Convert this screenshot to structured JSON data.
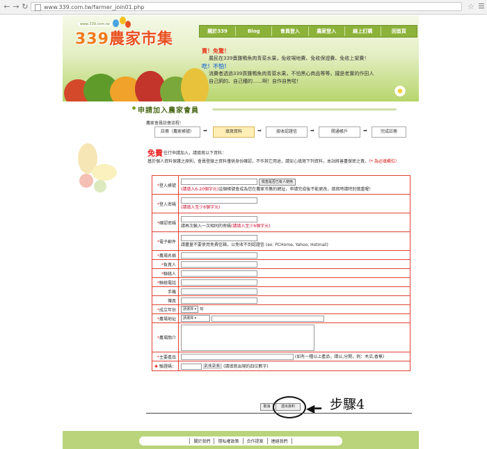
{
  "browser": {
    "url": "www.339.com.tw/farmer_join01.php"
  },
  "site": {
    "logo_url": "www.339.com.tw",
    "logo_num": "339",
    "logo_text": "農家市集",
    "nav": [
      "關於339",
      "Blog",
      "會員登入",
      "農家登入",
      "線上訂購",
      "回首頁"
    ]
  },
  "promo": {
    "h1": "賣！免驚！",
    "l1": "農民在339賣雞鴨魚肉青菜水果，免收場地費、免收保證費、免收上架費！",
    "h2": "吃！不怕！",
    "l2": "消費者透過339買雞鴨魚肉青菜水果，不怕黑心商品等等，攏是老實的作田人",
    "l3": "自己飼的、自己種的……啊！自作自售啦！"
  },
  "page": {
    "title": "申請加入農家會員",
    "flow_label": "農家會員註冊流程：",
    "steps": [
      "註冊（農家帳號）",
      "填寫資料",
      "接收認證信",
      "開通帳戶",
      "完成註冊"
    ],
    "free": "免費",
    "free_tail": "往行申請加入，請填寫以下資料：",
    "notice": "基於個人資料保護之原則，會員登錄之資料僅供身份確認，不作其它用途，請安心填寫下列資料，本站將善盡保密之責。",
    "notice_req": "（* 為必填欄位）"
  },
  "form": {
    "account": {
      "label": "登入帳號",
      "check_btn": "檢查是否已有人使用",
      "hint_red": "(請填入6-20個字元)",
      "hint": "這個帳號會成為您在農家市集的網址，申請完成後不能更改，填寫時請特別慎重喔！"
    },
    "password": {
      "label": "登入密碼",
      "hint_red": "(請填入至少6個字元)"
    },
    "confirm": {
      "label": "確認密碼",
      "hint": "請再次輸入一次相同的密碼",
      "hint_red": "(請填入至少6個字元)"
    },
    "email": {
      "label": "電子郵件",
      "hint": "請盡量不要使用免費信箱，以免收不到認證信 (ex: PCHome, Yahoo, Hotmail)"
    },
    "farm_name": "農場名稱",
    "owner": "負責人",
    "contact": "聯絡人",
    "phone": "聯絡電話",
    "mobile": "手機",
    "fax": "傳真",
    "year": {
      "label": "成立年份",
      "select": "請選擇",
      "unit": "年"
    },
    "address": {
      "label": "農場地址",
      "select": "請選擇"
    },
    "intro": "農場簡介",
    "products": {
      "label": "主要產品",
      "hint": "(如有一種以上產品，請以,分開，例：木瓜,香蕉)"
    },
    "captcha": {
      "label": "驗證碼：",
      "code": "2426",
      "hint": "(請填寫出現的四位數字)"
    }
  },
  "actions": {
    "cancel": "取消",
    "submit": "送出資料"
  },
  "annotation": {
    "label": "步驟4"
  },
  "footer": {
    "links": [
      "關於我們",
      "隱私權政策",
      "合作提案",
      "連絡我們"
    ]
  }
}
